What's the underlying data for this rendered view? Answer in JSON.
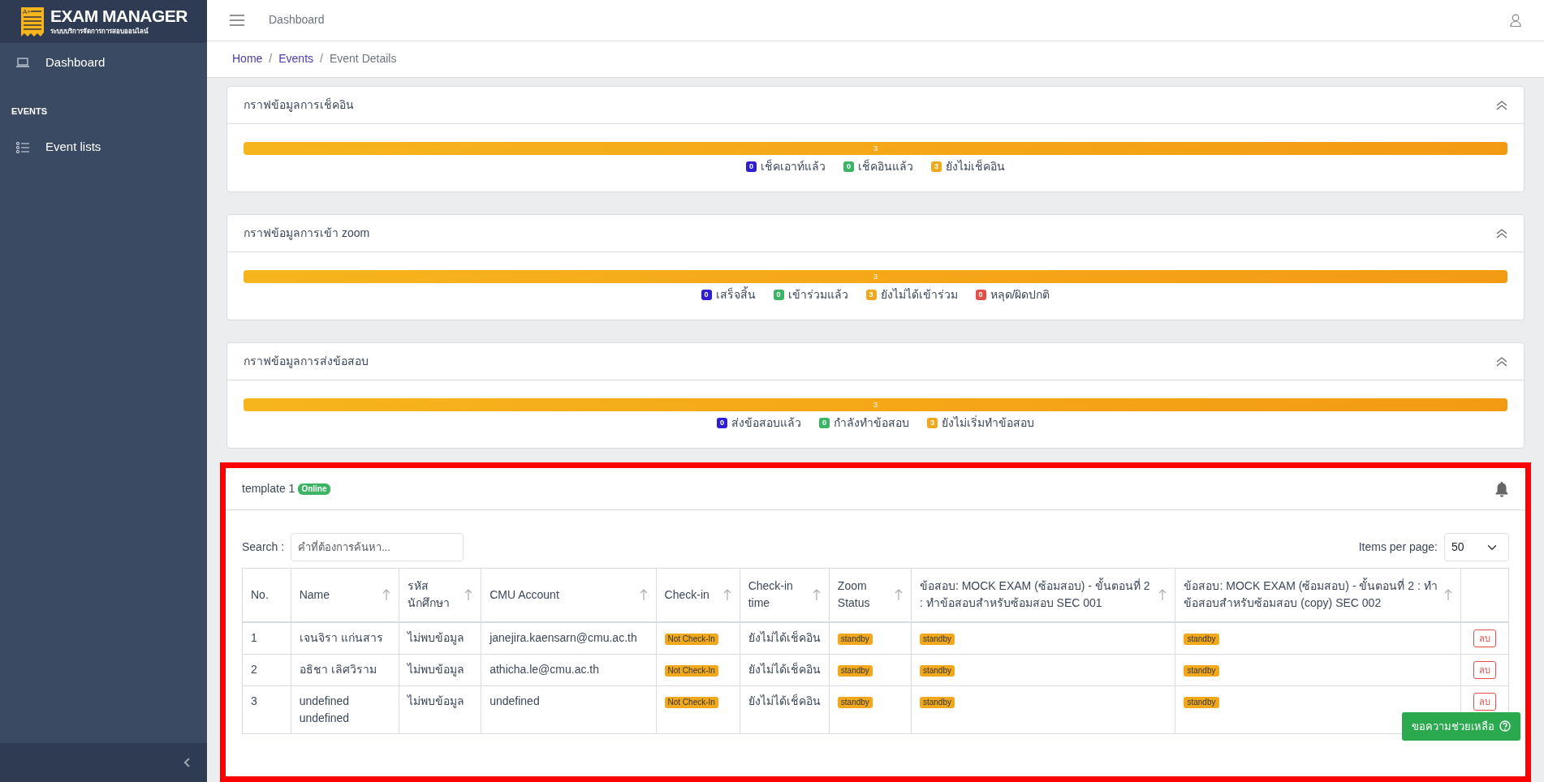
{
  "logo": {
    "mark": "A+",
    "title": "EXAM MANAGER",
    "subtitle": "ระบบบริการจัดการการสอบออนไลน์"
  },
  "sidebar": {
    "items": [
      {
        "kind": "link",
        "label": "Dashboard"
      },
      {
        "kind": "heading",
        "label": "EVENTS"
      },
      {
        "kind": "link",
        "label": "Event lists"
      }
    ]
  },
  "topbar": {
    "title": "Dashboard"
  },
  "breadcrumb": [
    {
      "label": "Home",
      "active": false
    },
    {
      "separator": "/",
      "label": "Events",
      "active": false
    },
    {
      "separator": "/",
      "label": "Event Details",
      "active": true
    }
  ],
  "charts": [
    {
      "title": "กราฟข้อมูลการเช็คอิน",
      "bar": {
        "label": "3",
        "level": 1
      },
      "legend": [
        {
          "count": "0",
          "label": "เช็คเอาท์แล้ว",
          "color": "#2f1fd0"
        },
        {
          "count": "0",
          "label": "เช็คอินแล้ว",
          "color": "#3bb464"
        },
        {
          "count": "3",
          "label": "ยังไม่เช็คอิน",
          "color": "#f0a81c"
        }
      ]
    },
    {
      "title": "กราฟข้อมูลการเข้า zoom",
      "bar": {
        "label": "3",
        "level": 1
      },
      "legend": [
        {
          "count": "0",
          "label": "เสร็จสิ้น",
          "color": "#2f1fd0"
        },
        {
          "count": "0",
          "label": "เข้าร่วมแล้ว",
          "color": "#3bb464"
        },
        {
          "count": "3",
          "label": "ยังไม่ได้เข้าร่วม",
          "color": "#f0a81c"
        },
        {
          "count": "0",
          "label": "หลุด/ผิดปกติ",
          "color": "#e0504b"
        }
      ]
    },
    {
      "title": "กราฟข้อมูลการส่งข้อสอบ",
      "bar": {
        "label": "3",
        "level": 1
      },
      "legend": [
        {
          "count": "0",
          "label": "ส่งข้อสอบแล้ว",
          "color": "#2f1fd0"
        },
        {
          "count": "0",
          "label": "กำลังทำข้อสอบ",
          "color": "#3bb464"
        },
        {
          "count": "3",
          "label": "ยังไม่เริ่มทำข้อสอบ",
          "color": "#f0a81c"
        }
      ]
    }
  ],
  "template": {
    "title": "template 1",
    "status": "Online",
    "highlighted": true,
    "search_label": "Search :",
    "search": {
      "placeholder": "คำที่ต้องการค้นหา..."
    },
    "per_page_label": "Items per page:",
    "per_page": "50",
    "table": {
      "columns": [
        "No.",
        "Name",
        "รหัสนักศึกษา",
        "CMU Account",
        "Check-in",
        "Check-in time",
        "Zoom Status",
        "ข้อสอบ: MOCK EXAM (ซ้อมสอบ) - ขั้นตอนที่ 2 : ทำข้อสอบสำหรับซ้อมสอบ SEC 001",
        "ข้อสอบ: MOCK EXAM (ซ้อมสอบ) - ขั้นตอนที่ 2 : ทำข้อสอบสำหรับซ้อมสอบ (copy) SEC 002"
      ],
      "rows": [
        {
          "no": "1",
          "name": "เจนจิรา แก่นสาร",
          "student_id": "ไม่พบข้อมูล",
          "account": "janejira.kaensarn@cmu.ac.th",
          "checkin": "Not Check-In",
          "checkin_time": "ยังไม่ได้เช็คอิน",
          "zoom": "standby",
          "exam_1": "standby",
          "exam_2": "standby",
          "action": "ลบ"
        },
        {
          "no": "2",
          "name": "อธิชา เลิศวิราม",
          "student_id": "ไม่พบข้อมูล",
          "account": "athicha.le@cmu.ac.th",
          "checkin": "Not Check-In",
          "checkin_time": "ยังไม่ได้เช็คอิน",
          "zoom": "standby",
          "exam_1": "standby",
          "exam_2": "standby",
          "action": "ลบ"
        },
        {
          "no": "3",
          "name": "undefined undefined",
          "student_id": "ไม่พบข้อมูล",
          "account": "undefined",
          "checkin": "Not Check-In",
          "checkin_time": "ยังไม่ได้เช็คอิน",
          "zoom": "standby",
          "exam_1": "standby",
          "exam_2": "standby",
          "action": "ลบ"
        }
      ]
    }
  },
  "help_button": "ขอความช่วยเหลือ"
}
